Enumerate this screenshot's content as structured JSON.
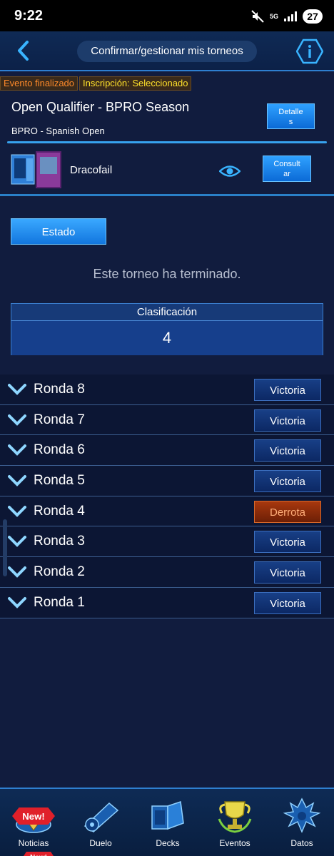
{
  "status_bar": {
    "time": "9:22",
    "network": "5G",
    "battery": "27"
  },
  "header": {
    "title": "Confirmar/gestionar mis torneos"
  },
  "tags": {
    "finished": "Evento finalizado",
    "inscription": "Inscripción: Seleccionado"
  },
  "event": {
    "name": "Open Qualifier - BPRO Season",
    "subtitle": "BPRO - Spanish Open",
    "details_label_1": "Detalle",
    "details_label_2": "s"
  },
  "deck": {
    "name": "Dracofail",
    "consult_label_1": "Consult",
    "consult_label_2": "ar"
  },
  "status_button": "Estado",
  "ended_message": "Este torneo ha terminado.",
  "ranking": {
    "label": "Clasificación",
    "value": "4"
  },
  "rounds": [
    {
      "label": "Ronda 8",
      "result": "Victoria"
    },
    {
      "label": "Ronda 7",
      "result": "Victoria"
    },
    {
      "label": "Ronda 6",
      "result": "Victoria"
    },
    {
      "label": "Ronda 5",
      "result": "Victoria"
    },
    {
      "label": "Ronda 4",
      "result": "Derrota"
    },
    {
      "label": "Ronda 3",
      "result": "Victoria"
    },
    {
      "label": "Ronda 2",
      "result": "Victoria"
    },
    {
      "label": "Ronda 1",
      "result": "Victoria"
    }
  ],
  "nav": {
    "news": "Noticias",
    "duel": "Duelo",
    "decks": "Decks",
    "events": "Eventos",
    "data": "Datos",
    "new_badge": "New!"
  },
  "colors": {
    "accent": "#2fa1ff",
    "victory_bg": "#183f86",
    "defeat_bg": "#a8380e",
    "background": "#111c3e"
  }
}
